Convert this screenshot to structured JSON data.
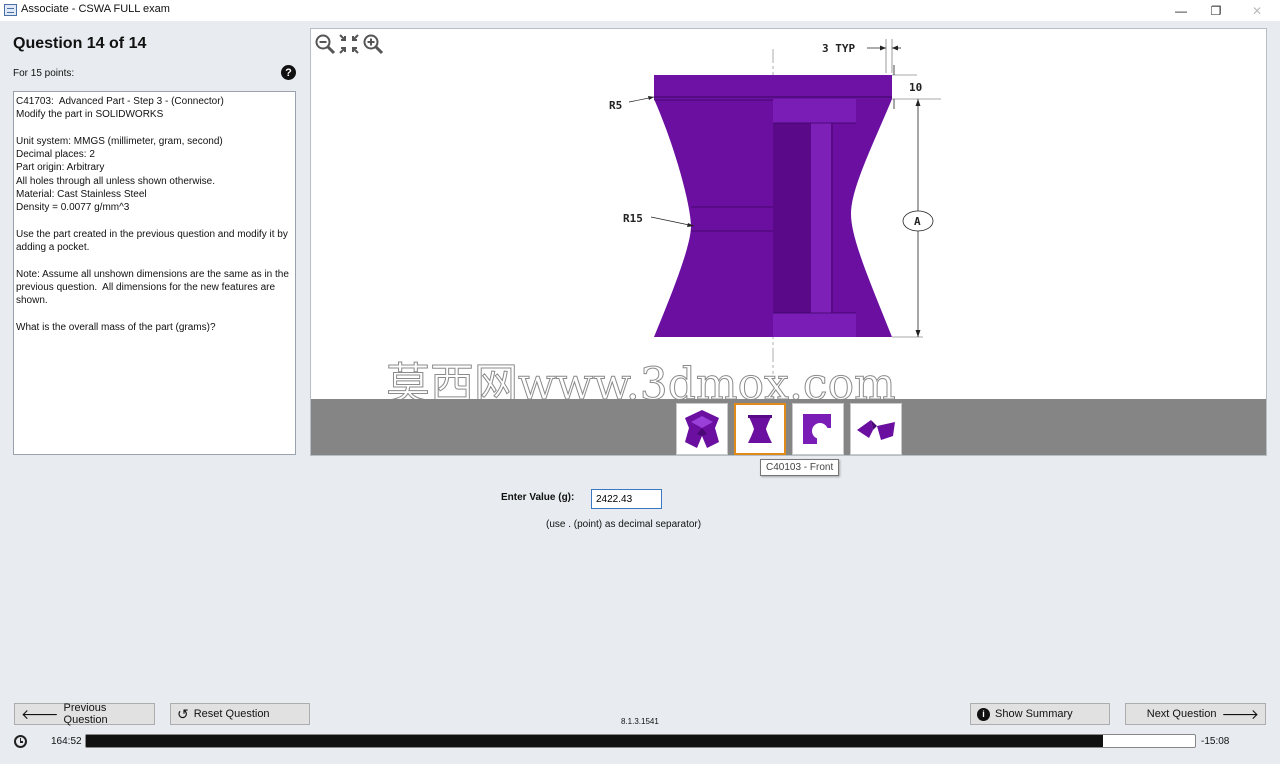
{
  "window": {
    "title": "Associate - CSWA FULL exam",
    "minimize": "—",
    "restore": "❐",
    "close": "✕"
  },
  "question": {
    "title": "Question 14 of 14",
    "points": "For 15 points:",
    "help": "?",
    "text": "C41703:  Advanced Part - Step 3 - (Connector)\nModify the part in SOLIDWORKS\n\nUnit system: MMGS (millimeter, gram, second)\nDecimal places: 2\nPart origin: Arbitrary\nAll holes through all unless shown otherwise.\nMaterial: Cast Stainless Steel\nDensity = 0.0077 g/mm^3\n\nUse the part created in the previous question and modify it by adding a pocket.\n\nNote: Assume all unshown dimensions are the same as in the previous question.  All dimensions for the new features are shown.\n\nWhat is the overall mass of the part (grams)?"
  },
  "drawing": {
    "dim_typ": "3 TYP",
    "dim_10": "10",
    "dim_r5": "R5",
    "dim_r15": "R15",
    "dim_a": "A",
    "watermark": "莫西网www.3dmox.com"
  },
  "thumbnails": {
    "active_index": 1,
    "tooltip": "C40103 - Front"
  },
  "answer": {
    "label": "Enter Value (g):",
    "value": "2422.43",
    "note": "(use . (point) as decimal separator)"
  },
  "buttons": {
    "previous": "Previous Question",
    "reset": "Reset Question",
    "summary": "Show Summary",
    "next": "Next Question"
  },
  "version": "8.1.3.1541",
  "timer": {
    "elapsed": "164:52",
    "remaining": "-15:08",
    "progress_fraction": 0.917
  },
  "colors": {
    "part_main": "#6a0fa0",
    "part_dark": "#52087e",
    "part_light": "#8a2cc8",
    "thumb_active_border": "#e08a1c"
  }
}
